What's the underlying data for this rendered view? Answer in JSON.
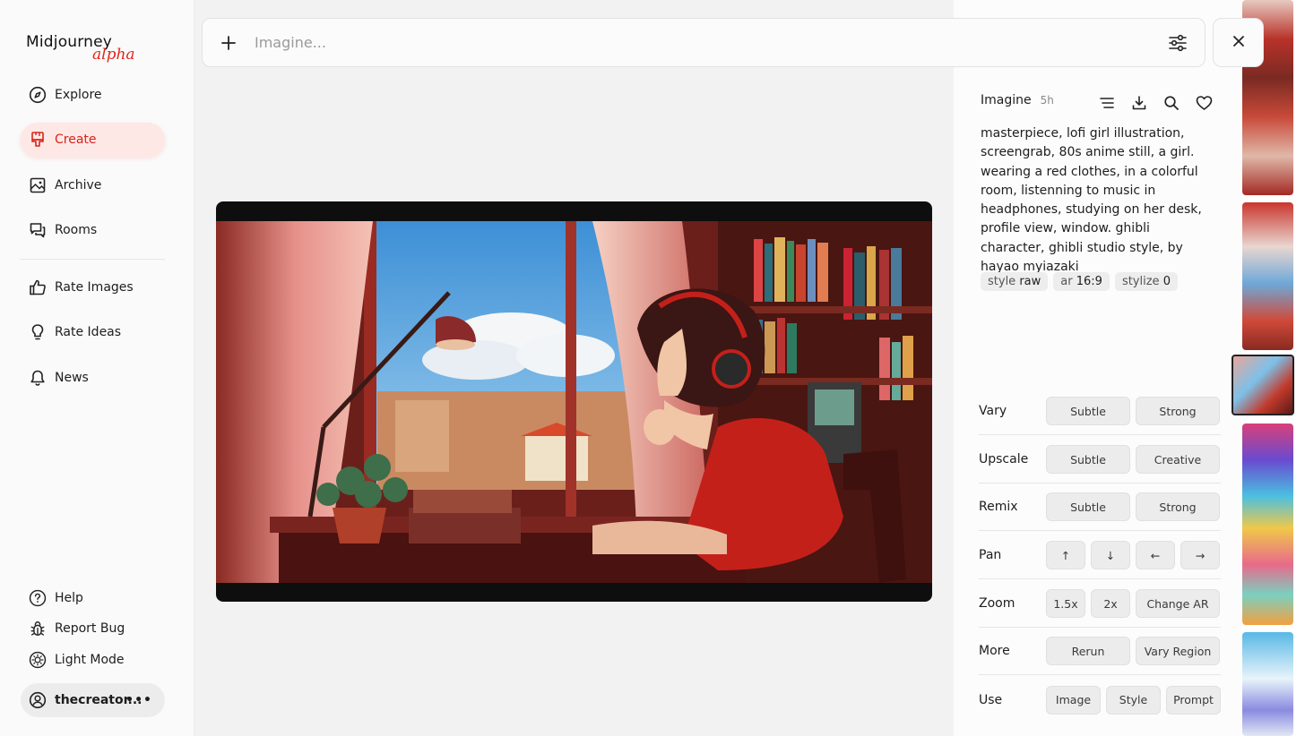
{
  "app": {
    "logo_text": "Midjourney",
    "logo_badge": "alpha"
  },
  "sidebar": {
    "nav": [
      {
        "label": "Explore",
        "icon": "compass-icon"
      },
      {
        "label": "Create",
        "icon": "brush-icon",
        "active": true
      },
      {
        "label": "Archive",
        "icon": "image-icon"
      },
      {
        "label": "Rooms",
        "icon": "chat-icon"
      }
    ],
    "secondary": [
      {
        "label": "Rate Images",
        "icon": "thumbs-up-icon"
      },
      {
        "label": "Rate Ideas",
        "icon": "lightbulb-icon"
      },
      {
        "label": "News",
        "icon": "bell-icon"
      }
    ],
    "footer": [
      {
        "label": "Help",
        "icon": "help-icon"
      },
      {
        "label": "Report Bug",
        "icon": "bug-icon"
      },
      {
        "label": "Light Mode",
        "icon": "sun-icon"
      }
    ],
    "user": {
      "name": "thecreator...",
      "more": "•••"
    }
  },
  "prompt_bar": {
    "placeholder": "Imagine..."
  },
  "detail": {
    "title": "Imagine",
    "time": "5h",
    "prompt": "masterpiece, lofi girl illustration, screengrab, 80s anime still, a girl. wearing a red clothes, in a colorful room, listenning to music in headphones, studying on her desk, profile view, window. ghibli character, ghibli studio style, by hayao myiazaki",
    "tags": [
      {
        "key": "style",
        "value": "raw"
      },
      {
        "key": "ar",
        "value": "16:9"
      },
      {
        "key": "stylize",
        "value": "0"
      }
    ],
    "actions": [
      {
        "label": "Vary",
        "buttons": [
          "Subtle",
          "Strong"
        ]
      },
      {
        "label": "Upscale",
        "buttons": [
          "Subtle",
          "Creative"
        ]
      },
      {
        "label": "Remix",
        "buttons": [
          "Subtle",
          "Strong"
        ]
      },
      {
        "label": "Pan",
        "buttons": [
          "↑",
          "↓",
          "←",
          "→"
        ]
      },
      {
        "label": "Zoom",
        "buttons": [
          "1.5x",
          "2x",
          "Change AR"
        ]
      },
      {
        "label": "More",
        "buttons": [
          "Rerun",
          "Vary Region"
        ]
      },
      {
        "label": "Use",
        "buttons": [
          "Image",
          "Style",
          "Prompt"
        ]
      }
    ]
  },
  "colors": {
    "accent": "#e5241b",
    "accent_bg": "#fde8e6"
  }
}
